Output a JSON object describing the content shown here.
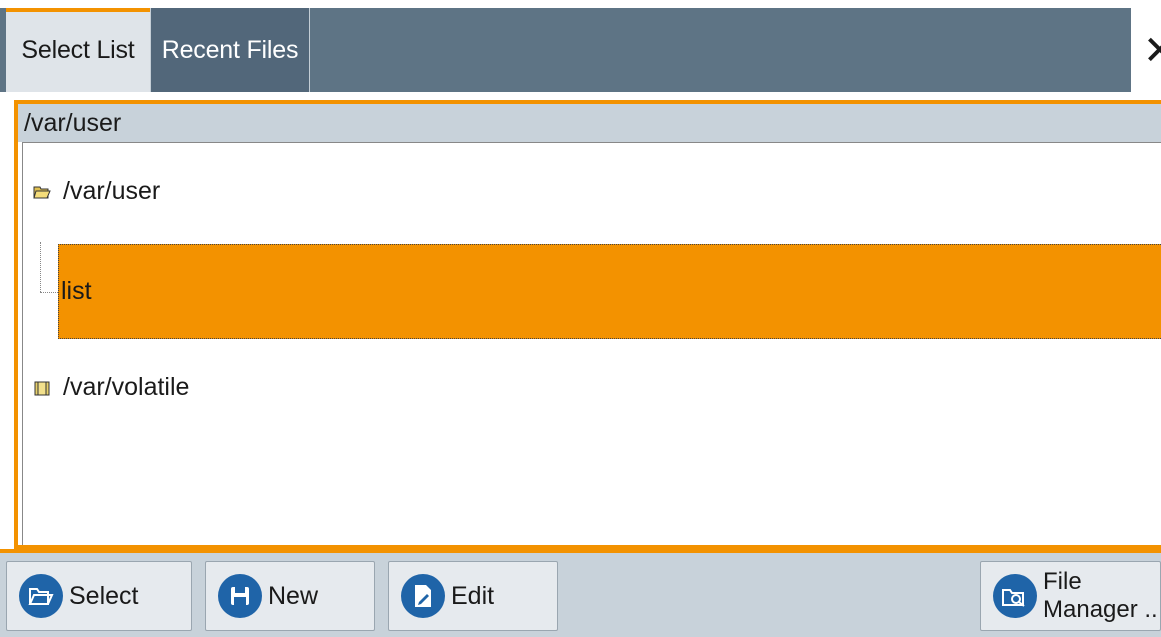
{
  "tabs": [
    {
      "label": "Select List",
      "active": true
    },
    {
      "label": "Recent Files",
      "active": false
    }
  ],
  "close_glyph": "✕",
  "current_path": "/var/user",
  "tree": {
    "root": {
      "label": "/var/user",
      "icon": "folder-open-icon"
    },
    "selected_item": {
      "label": "list"
    },
    "sibling": {
      "label": "/var/volatile",
      "icon": "folder-closed-icon"
    }
  },
  "buttons": {
    "select": {
      "label": "Select",
      "icon": "folder-open-icon"
    },
    "new": {
      "label": "New",
      "icon": "floppy-disk-icon"
    },
    "edit": {
      "label": "Edit",
      "icon": "edit-document-icon"
    },
    "file_manager": {
      "label_line1": "File",
      "label_line2": "Manager ..",
      "icon": "folder-search-icon"
    }
  },
  "colors": {
    "accent": "#f39200",
    "tabbar": "#5e7485",
    "button_icon": "#1f64a8",
    "panel_header": "#c8d2da"
  }
}
